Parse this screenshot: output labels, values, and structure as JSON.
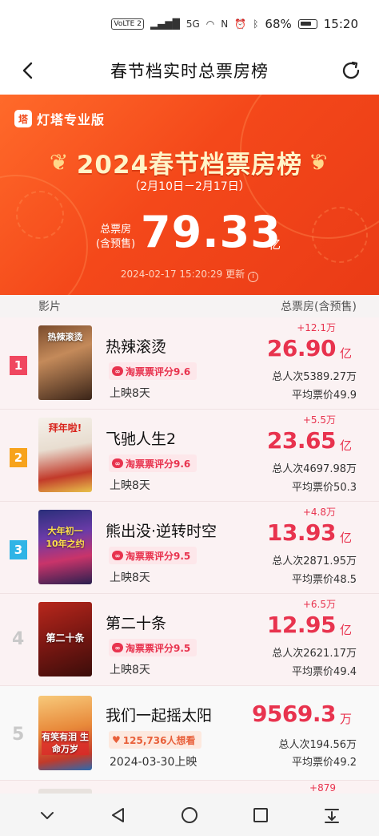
{
  "status_bar": {
    "volte": "VoLTE 2",
    "network": "5G",
    "battery": "68%",
    "time": "15:20"
  },
  "nav": {
    "title": "春节档实时总票房榜"
  },
  "hero": {
    "brand": "灯塔专业版",
    "title": "2024春节档票房榜",
    "date_range": "（2月10日－2月17日）",
    "total_label_1": "总票房",
    "total_label_2": "(含预售)",
    "total_value": "79.33",
    "total_unit": "亿",
    "updated": "2024-02-17 15:20:29 更新",
    "colors": {
      "bg": "#f4481a",
      "title": "#fff4c8"
    }
  },
  "list_header": {
    "col_film": "影片",
    "col_gross": "总票房(含预售)"
  },
  "movies": [
    {
      "rank": "1",
      "title": "热辣滚烫",
      "poster_text": "热辣滚烫",
      "rating": "淘票票评分9.6",
      "release": "上映8天",
      "delta": "+12.1万",
      "gross": "26.90",
      "unit": "亿",
      "admissions": "总人次5389.27万",
      "avg_price": "平均票价49.9"
    },
    {
      "rank": "2",
      "title": "飞驰人生2",
      "poster_text": "拜年啦!",
      "rating": "淘票票评分9.6",
      "release": "上映8天",
      "delta": "+5.5万",
      "gross": "23.65",
      "unit": "亿",
      "admissions": "总人次4697.98万",
      "avg_price": "平均票价50.3"
    },
    {
      "rank": "3",
      "title": "熊出没·逆转时空",
      "poster_text": "大年初一 10年之约",
      "rating": "淘票票评分9.5",
      "release": "上映8天",
      "delta": "+4.8万",
      "gross": "13.93",
      "unit": "亿",
      "admissions": "总人次2871.95万",
      "avg_price": "平均票价48.5"
    },
    {
      "rank": "4",
      "title": "第二十条",
      "poster_text": "第二十条",
      "rating": "淘票票评分9.5",
      "release": "上映8天",
      "delta": "+6.5万",
      "gross": "12.95",
      "unit": "亿",
      "admissions": "总人次2621.17万",
      "avg_price": "平均票价49.4"
    },
    {
      "rank": "5",
      "title": "我们一起摇太阳",
      "poster_text": "有笑有泪 生命万岁",
      "want": "125,736人想看",
      "release": "2024-03-30上映",
      "gross": "9569.3",
      "unit": "万",
      "admissions": "总人次194.56万",
      "avg_price": "平均票价49.2"
    }
  ],
  "next_row": {
    "delta": "+879"
  },
  "icons": {
    "back": "chevron-left-icon",
    "refresh": "refresh-icon",
    "rating": "taopiaopiao-icon",
    "want": "heart-icon"
  }
}
